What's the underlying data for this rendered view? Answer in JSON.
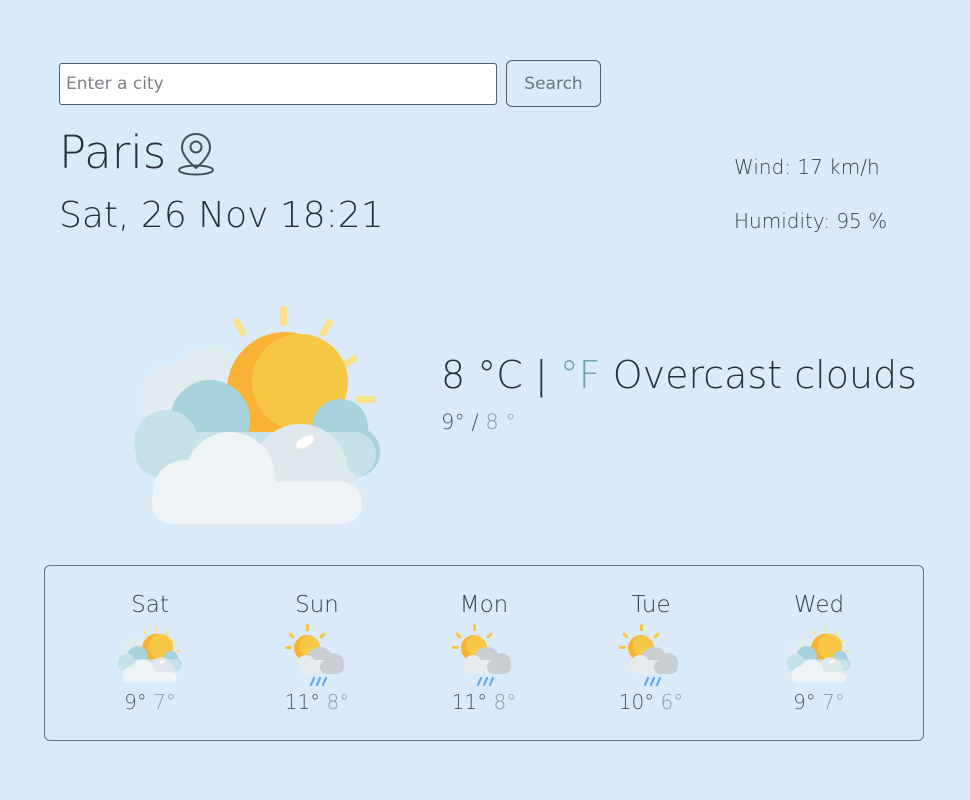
{
  "search": {
    "placeholder": "Enter a city",
    "value": "",
    "button_label": "Search"
  },
  "location": {
    "city": "Paris",
    "pin_icon": "location-pin-icon",
    "datetime": "Sat, 26 Nov 18:21"
  },
  "details": {
    "wind": "Wind: 17 km/h",
    "humidity": "Humidity: 95 %"
  },
  "current": {
    "icon": "sun-behind-clouds-icon",
    "temperature": "8",
    "unit_c": " °C",
    "separator": " | ",
    "unit_f": "°F",
    "description": " Overcast clouds",
    "high": "9°",
    "slash": " / ",
    "low": "8 °"
  },
  "forecast": [
    {
      "day": "Sat",
      "icon": "sun-behind-clouds-icon",
      "high": "9°",
      "low": "7°"
    },
    {
      "day": "Sun",
      "icon": "sun-cloud-rain-icon",
      "high": "11°",
      "low": "8°"
    },
    {
      "day": "Mon",
      "icon": "sun-cloud-rain-icon",
      "high": "11°",
      "low": "8°"
    },
    {
      "day": "Tue",
      "icon": "sun-cloud-rain-icon",
      "high": "10°",
      "low": "6°"
    },
    {
      "day": "Wed",
      "icon": "sun-behind-clouds-icon",
      "high": "9°",
      "low": "7°"
    }
  ],
  "colors": {
    "background": "#dbeaf9",
    "text": "#2a2f36",
    "fahrenheit_link": "#6fa3b2",
    "muted": "#8e969e",
    "sun": "#f9b233",
    "cloud_light": "#eef3f6",
    "cloud_blue": "#a8d3dc"
  }
}
